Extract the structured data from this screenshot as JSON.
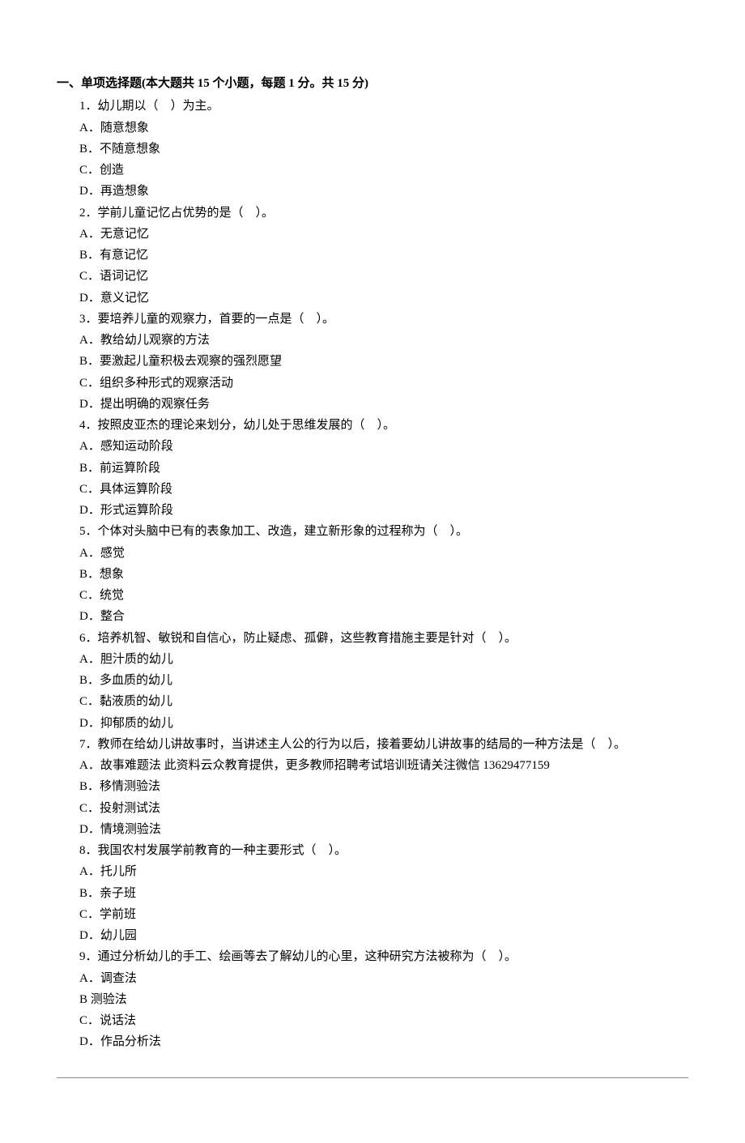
{
  "section_title": "一、单项选择题(本大题共 15 个小题，每题 1 分。共 15 分)",
  "questions": [
    {
      "stem": "1．幼儿期以（　）为主。",
      "options": [
        "A．随意想象",
        "B．不随意想象",
        "C．创造",
        "D．再造想象"
      ]
    },
    {
      "stem": "2．学前儿童记忆占优势的是（　）。",
      "options": [
        "A．无意记忆",
        "B．有意记忆",
        "C．语词记忆",
        "D．意义记忆"
      ]
    },
    {
      "stem": "3．要培养儿童的观察力，首要的一点是（　）。",
      "options": [
        "A．教给幼儿观察的方法",
        "B．要激起儿童积极去观察的强烈愿望",
        "C．组织多种形式的观察活动",
        "D．提出明确的观察任务"
      ]
    },
    {
      "stem": "4．按照皮亚杰的理论来划分，幼儿处于思维发展的（　）。",
      "options": [
        "A．感知运动阶段",
        "B．前运算阶段",
        "C．具体运算阶段",
        "D．形式运算阶段"
      ]
    },
    {
      "stem": "5．个体对头脑中已有的表象加工、改造，建立新形象的过程称为（　）。",
      "options": [
        "A．感觉",
        "B．想象",
        "C．统觉",
        "D．整合"
      ]
    },
    {
      "stem": "6．培养机智、敏锐和自信心，防止疑虑、孤僻，这些教育措施主要是针对（　）。",
      "options": [
        "A．胆汁质的幼儿",
        "B．多血质的幼儿",
        "C．黏液质的幼儿",
        "D．抑郁质的幼儿"
      ]
    },
    {
      "stem": "7．教师在给幼儿讲故事时，当讲述主人公的行为以后，接着要幼儿讲故事的结局的一种方法是（　）。",
      "options": [
        "A．故事难题法 此资料云众教育提供，更多教师招聘考试培训班请关注微信 13629477159",
        "B．移情测验法",
        "C．投射测试法",
        "D．情境测验法"
      ]
    },
    {
      "stem": "8．我国农村发展学前教育的一种主要形式（　）。",
      "options": [
        "A．托儿所",
        "B．亲子班",
        "C．学前班",
        "D．幼儿园"
      ]
    },
    {
      "stem": "9．通过分析幼儿的手工、绘画等去了解幼儿的心里，这种研究方法被称为（　）。",
      "options": [
        "A．调查法",
        "B 测验法",
        "C．说话法",
        "D．作品分析法"
      ]
    }
  ]
}
